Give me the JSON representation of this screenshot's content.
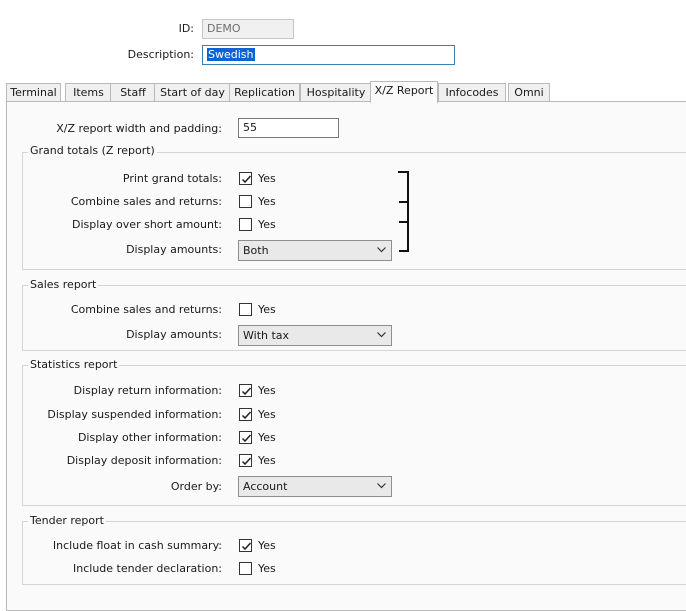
{
  "header": {
    "id_label": "ID:",
    "id_value": "DEMO",
    "description_label": "Description:",
    "description_value": "Swedish"
  },
  "tabs": [
    {
      "label": "Terminal"
    },
    {
      "label": "Items"
    },
    {
      "label": "Staff"
    },
    {
      "label": "Start of day"
    },
    {
      "label": "Replication"
    },
    {
      "label": "Hospitality"
    },
    {
      "label": "X/Z Report",
      "active": true
    },
    {
      "label": "Infocodes"
    },
    {
      "label": "Omni"
    }
  ],
  "report_width": {
    "label": "X/Z report width and padding:",
    "value": "55"
  },
  "grand_totals": {
    "title": "Grand totals (Z report)",
    "print_grand_totals": {
      "label": "Print grand totals:",
      "checked": true,
      "option": "Yes"
    },
    "combine_sales_returns": {
      "label": "Combine sales and returns:",
      "checked": false,
      "option": "Yes"
    },
    "display_over_short": {
      "label": "Display over short amount:",
      "checked": false,
      "option": "Yes"
    },
    "display_amounts": {
      "label": "Display amounts:",
      "value": "Both"
    }
  },
  "sales_report": {
    "title": "Sales report",
    "combine_sales_returns": {
      "label": "Combine sales and returns:",
      "checked": false,
      "option": "Yes"
    },
    "display_amounts": {
      "label": "Display amounts:",
      "value": "With tax"
    }
  },
  "statistics_report": {
    "title": "Statistics report",
    "return_info": {
      "label": "Display return information:",
      "checked": true,
      "option": "Yes"
    },
    "suspended_info": {
      "label": "Display suspended information:",
      "checked": true,
      "option": "Yes"
    },
    "other_info": {
      "label": "Display other information:",
      "checked": true,
      "option": "Yes"
    },
    "deposit_info": {
      "label": "Display deposit information:",
      "checked": true,
      "option": "Yes"
    },
    "order_by": {
      "label": "Order by:",
      "value": "Account"
    }
  },
  "tender_report": {
    "title": "Tender report",
    "include_float": {
      "label": "Include float in cash summary:",
      "checked": true,
      "option": "Yes"
    },
    "include_declaration": {
      "label": "Include tender declaration:",
      "checked": false,
      "option": "Yes"
    }
  },
  "colors": {
    "selection": "#0a64d6",
    "panel": "#fafafa",
    "tab_border": "#b9b9b9"
  }
}
